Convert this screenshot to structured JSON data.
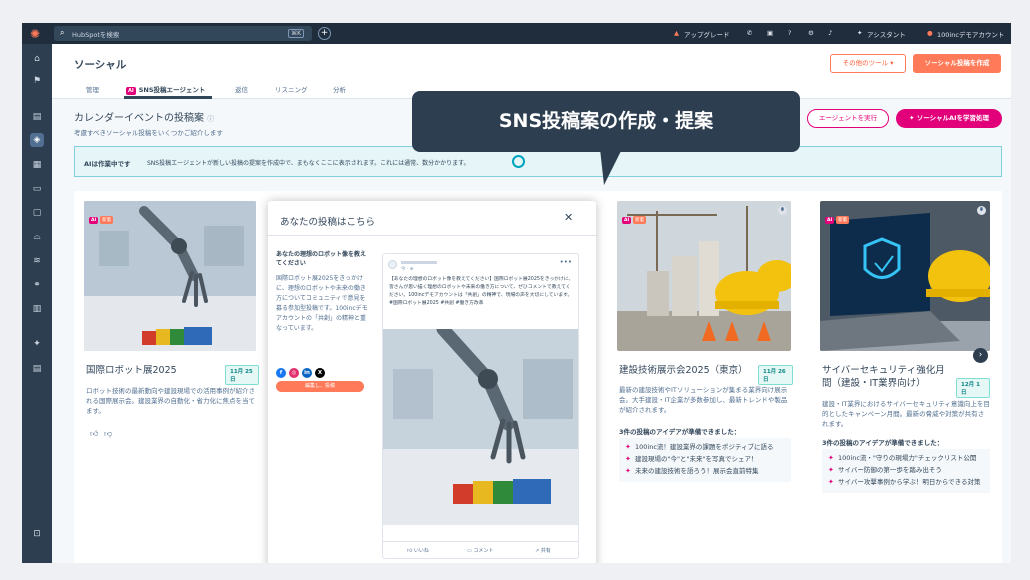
{
  "topbar": {
    "search_placeholder": "HubSpotを検索",
    "search_shortcut": "⌘K",
    "upgrade": "アップグレード",
    "assistant": "アシスタント",
    "account": "100incデモアカウント"
  },
  "header": {
    "title": "ソーシャル",
    "tabs": [
      {
        "label": "管理"
      },
      {
        "label": "SNS投稿エージェント",
        "badge": "AI"
      },
      {
        "label": "返信"
      },
      {
        "label": "リスニング"
      },
      {
        "label": "分析"
      }
    ],
    "other_tools": "その他のツール",
    "create_post": "ソーシャル投稿を作成"
  },
  "section": {
    "title": "カレンダーイベントの投稿案",
    "subtitle": "考慮すべきソーシャル投稿をいくつかご紹介します",
    "run_agent": "エージェントを実行",
    "learn": "ソーシャルAIを学習処理"
  },
  "status": {
    "label": "AIは作業中です",
    "message": "SNS投稿エージェントが新しい投稿の提案を作成中で、まもなくここに表示されます。これには通常、数分かかります。"
  },
  "callout": {
    "text": "SNS投稿案の作成・提案"
  },
  "cards": [
    {
      "badge_ai": "AI",
      "badge_new": "新着",
      "title": "国際ロボット展2025",
      "date": "11月 25日",
      "desc": "ロボット技術の最新動向や建設現場での活用事例が紹介される国際展示会。建設業界の自動化・省力化に焦点を当てます。"
    },
    {
      "badge_ai": "AI",
      "badge_new": "新着",
      "title": "建設技術展示会2025（東京）",
      "date": "11月 26日",
      "desc": "最新の建設技術やITソリューションが集まる業界向け展示会。大手建設・IT企業が多数参加し、最新トレンドや製品が紹介されます。",
      "ideas_title": "3件の投稿のアイデアが準備できました：",
      "ideas": [
        "100inc流！建設業界の課題をポジティブに語る",
        "建設現場の\"今\"と\"未来\"を写真でシェア！",
        "未来の建設技術を語ろう！展示会直前特集"
      ]
    },
    {
      "badge_ai": "AI",
      "badge_new": "新着",
      "title": "サイバーセキュリティ強化月間（建設・IT業界向け）",
      "date": "12月 1日",
      "desc": "建設・IT業界におけるサイバーセキュリティ意識向上を目的としたキャンペーン月間。最新の脅威や対策が共有されます。",
      "ideas_title": "3件の投稿のアイデアが準備できました：",
      "ideas": [
        "100inc流・\"守りの現場力\"チェックリスト公開",
        "サイバー防御の第一歩を踏み出そう",
        "サイバー攻撃事例から学ぶ！明日からできる対策"
      ]
    }
  ],
  "modal": {
    "title": "あなたの投稿はこちら",
    "hint": "あなたの理想のロボット像を教えてください",
    "prompt": "国際ロボット展2025をきっかけに、理想のロボットや未来の働き方についてコミュニティで意見を募る参加型投稿です。100incデモアカウントの「共創」の精神と重なっています。",
    "edit_button": "編集し、投稿",
    "preview": {
      "meta": "今 · ⊕",
      "text": "【あなたの理想のロボット像を教えてください】国際ロボット展2025をきっかけに、皆さんが思い描く理想のロボットや未来の働き方について、ぜひコメントで教えてください。100incデモアカウントは「共創」の精神で、現場の声を大切にしています。#国際ロボット展2025 #共創 #働き方改革",
      "like": "いいね",
      "comment": "コメント",
      "share": "共有"
    }
  },
  "colors": {
    "accent_orange": "#ff7a59",
    "ai_magenta": "#e2007a",
    "nav_dark": "#1f2d3d",
    "status_teal": "#00a4bd"
  }
}
